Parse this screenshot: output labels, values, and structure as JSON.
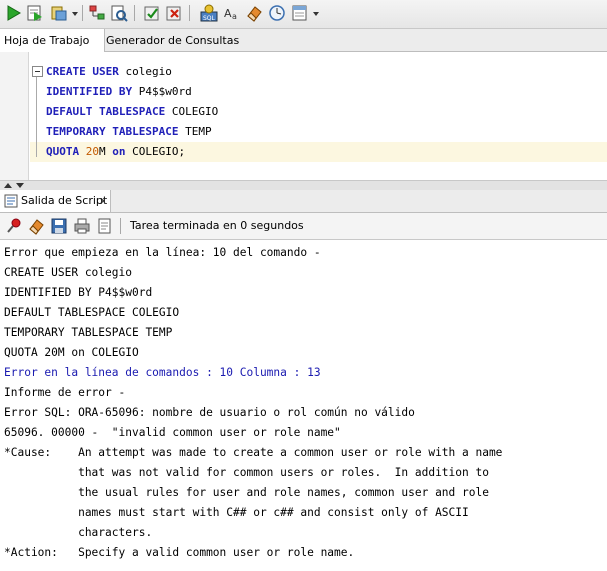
{
  "toolbar": {
    "icons": [
      "run-statement-icon",
      "run-script-icon",
      "autotrace-icon",
      "explain-plan-icon",
      "sql-tuning-icon",
      "commit-icon",
      "rollback-icon",
      "sql-history-icon",
      "format-icon",
      "clear-icon",
      "history-icon",
      "unshared-worksheet-icon"
    ]
  },
  "tabs": {
    "worksheet": "Hoja de Trabajo",
    "query_builder": "Generador de Consultas"
  },
  "editor": {
    "lines": [
      {
        "kw": "CREATE USER",
        "rest": " colegio"
      },
      {
        "kw": "IDENTIFIED BY",
        "rest": " P4$$w0rd"
      },
      {
        "kw": "DEFAULT TABLESPACE",
        "rest": " COLEGIO"
      },
      {
        "kw": "TEMPORARY TABLESPACE",
        "rest": " TEMP"
      },
      {
        "kw": "QUOTA",
        "num": " 20",
        "rest2": "M",
        "kw2": " on",
        "rest": " COLEGIO;"
      }
    ]
  },
  "output_panel": {
    "tab_label": "Salida de Script",
    "close": "x",
    "status": "Tarea terminada en 0 segundos",
    "lines": [
      "Error que empieza en la línea: 10 del comando -",
      "CREATE USER colegio",
      "IDENTIFIED BY P4$$w0rd",
      "DEFAULT TABLESPACE COLEGIO",
      "TEMPORARY TABLESPACE TEMP",
      "QUOTA 20M on COLEGIO",
      "Error en la línea de comandos : 10 Columna : 13",
      "Informe de error -",
      "Error SQL: ORA-65096: nombre de usuario o rol común no válido",
      "65096. 00000 -  \"invalid common user or role name\"",
      "*Cause:    An attempt was made to create a common user or role with a name",
      "           that was not valid for common users or roles.  In addition to",
      "           the usual rules for user and role names, common user and role",
      "           names must start with C## or c## and consist only of ASCII",
      "           characters.",
      "*Action:   Specify a valid common user or role name."
    ]
  },
  "colors": {
    "keyword": "#1f1fb8",
    "error_link": "#1a1ab0",
    "number": "#c25a00"
  }
}
